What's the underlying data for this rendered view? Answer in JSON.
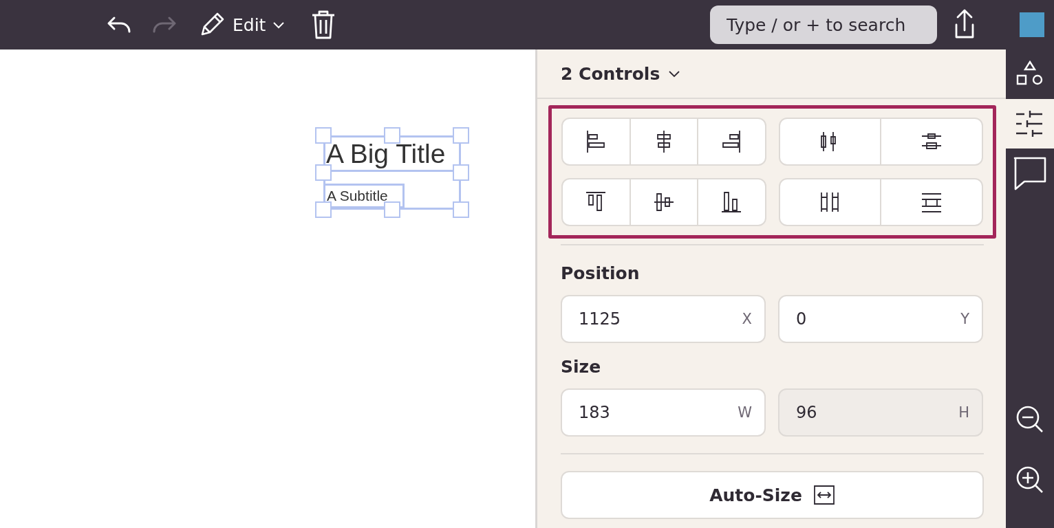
{
  "toolbar": {
    "history": [
      {
        "kind": "undo",
        "disabled": false
      },
      {
        "kind": "redo",
        "disabled": true
      }
    ],
    "edit_label": "Edit",
    "search": {
      "placeholder": "Type / or + to search"
    }
  },
  "canvas": {
    "title": "A Big Title",
    "subtitle": "A Subtitle"
  },
  "panel": {
    "header": "2 Controls",
    "align_rows": [
      [
        [
          {
            "kind": "left"
          },
          {
            "kind": "center-h"
          },
          {
            "kind": "right"
          }
        ],
        [
          {
            "kind": "distribute-h"
          },
          {
            "kind": "distribute-v"
          }
        ]
      ],
      [
        [
          {
            "kind": "top"
          },
          {
            "kind": "middle-v"
          },
          {
            "kind": "bottom"
          }
        ],
        [
          {
            "kind": "space-h"
          },
          {
            "kind": "space-v"
          }
        ]
      ]
    ],
    "sections": [
      {
        "label": "Position",
        "fields": [
          {
            "value": "1125",
            "unit": "X",
            "disabled": false
          },
          {
            "value": "0",
            "unit": "Y",
            "disabled": false
          }
        ]
      },
      {
        "label": "Size",
        "fields": [
          {
            "value": "183",
            "unit": "W",
            "disabled": false
          },
          {
            "value": "96",
            "unit": "H",
            "disabled": true
          }
        ]
      }
    ],
    "auto_size_label": "Auto-Size"
  },
  "rail": {
    "tabs": [
      {
        "kind": "shapes",
        "selected": false
      },
      {
        "kind": "controls",
        "selected": true
      },
      {
        "kind": "comments",
        "selected": false
      }
    ],
    "zoom": [
      {
        "kind": "zoom-out"
      },
      {
        "kind": "zoom-in"
      }
    ]
  }
}
